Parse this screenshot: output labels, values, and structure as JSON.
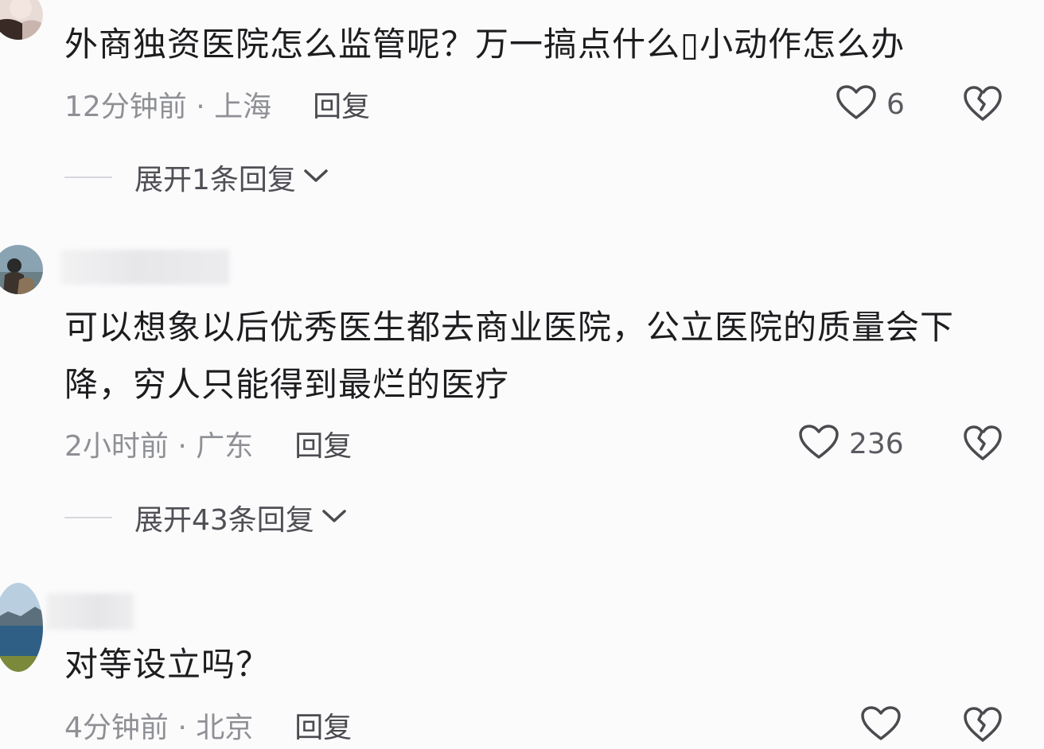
{
  "comments": [
    {
      "text": "外商独资医院怎么监管呢？万一搞点什么▯小动作怎么办",
      "time_location": "12分钟前 · 上海",
      "reply_label": "回复",
      "likes": "6",
      "expand_label": "展开1条回复",
      "avatar_icon": "avatar-photo"
    },
    {
      "text": "可以想象以后优秀医生都去商业医院，公立医院的质量会下降，穷人只能得到最烂的医疗",
      "time_location": "2小时前 · 广东",
      "reply_label": "回复",
      "likes": "236",
      "expand_label": "展开43条回复",
      "avatar_icon": "avatar-photo"
    },
    {
      "text": "对等设立吗？",
      "time_location": "4分钟前 · 北京",
      "reply_label": "回复",
      "likes": "",
      "avatar_icon": "avatar-photo"
    }
  ],
  "icons": {
    "like": "heart-outline-icon",
    "dislike": "broken-heart-icon",
    "expand": "chevron-down-icon"
  },
  "colors": {
    "text": "#1d1d1f",
    "meta": "#8f9095",
    "icon": "#4a4a4f",
    "background": "#fbfbfc"
  }
}
